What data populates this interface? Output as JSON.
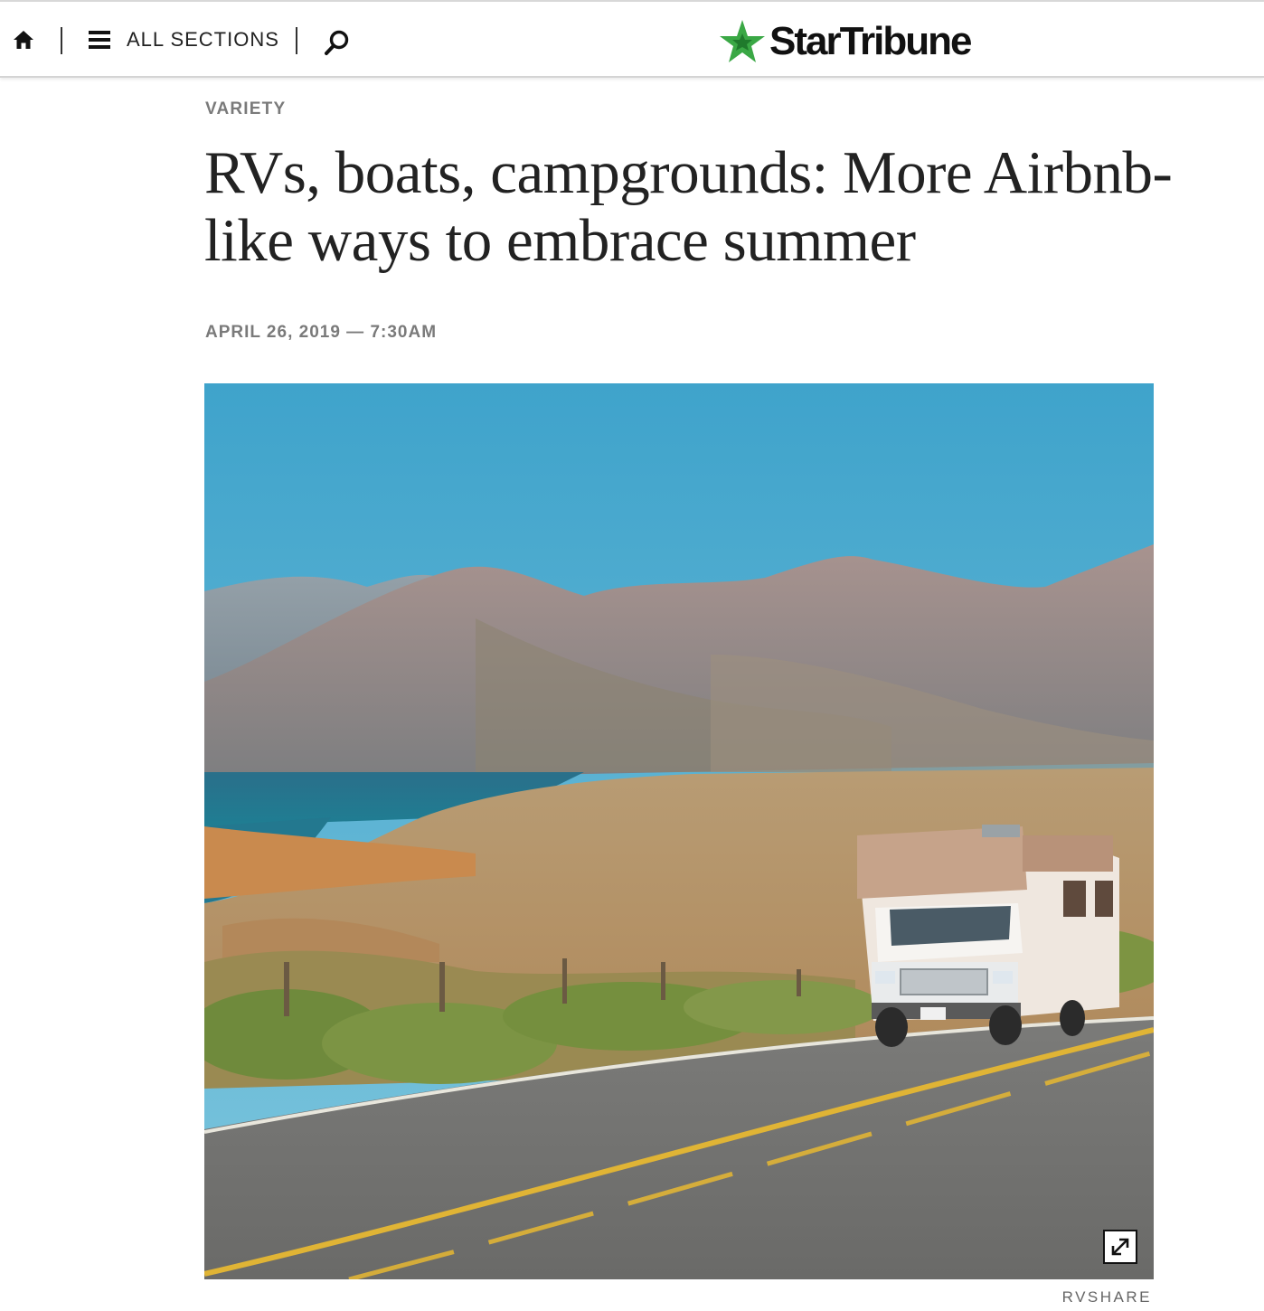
{
  "header": {
    "home_icon": "home-icon",
    "menu_icon": "hamburger-icon",
    "sections_label": "ALL SECTIONS",
    "search_icon": "search-icon",
    "logo_text": "StarTribune",
    "logo_star_color": "#3aa845"
  },
  "article": {
    "kicker": "VARIETY",
    "headline": "RVs, boats, campgrounds: More Airbnb-like ways to embrace summer",
    "dateline": "APRIL 26, 2019 — 7:30AM"
  },
  "photo": {
    "subject": "motorhome-on-coastal-highway",
    "expand_icon": "expand-icon",
    "credit": "RVSHARE"
  }
}
